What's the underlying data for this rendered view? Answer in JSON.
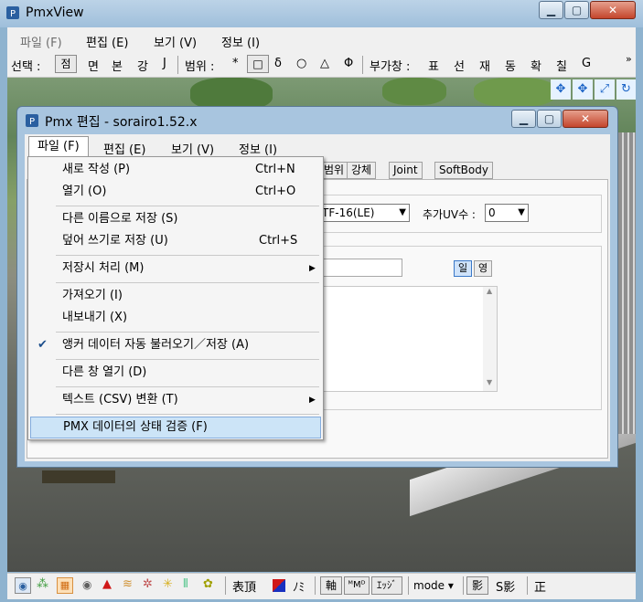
{
  "main_window": {
    "title": "PmxView",
    "menu": [
      "파일 (F)",
      "편집 (E)",
      "보기 (V)",
      "정보 (I)"
    ],
    "toolbar": {
      "select_label": "선택 :",
      "select_items": [
        "점",
        "면",
        "본",
        "강",
        "J"
      ],
      "range_label": "범위 :",
      "range_items": [
        "*",
        "□",
        "δ",
        "○",
        "△",
        "Φ"
      ],
      "extra_label": "부가창 :",
      "extra_items": [
        "표",
        "선",
        "재",
        "동",
        "확",
        "칠",
        "G"
      ],
      "overflow": "»"
    },
    "bottom_toolbar": {
      "text_a": "表頂",
      "text_b": "ﾉﾐ",
      "axis": "軸",
      "mmd": "ᴹMᴰ",
      "edge": "ｴｯｼﾞ",
      "mode": "mode ▾",
      "shadow": "影",
      "s_shadow": "S影",
      "front": "正"
    }
  },
  "editor_window": {
    "title": "Pmx 편집 - sorairo1.52.x",
    "menu": [
      "파일 (F)",
      "편집 (E)",
      "보기 (V)",
      "정보 (I)"
    ],
    "tabs": [
      "범위",
      "강체",
      "Joint",
      "SoftBody"
    ],
    "encoding_value": "TF-16(LE)",
    "uv_label": "추가UV수 :",
    "uv_value": "0",
    "lang_buttons": [
      "일",
      "영"
    ]
  },
  "file_menu": {
    "items": [
      {
        "label": "새로 작성 (P)",
        "shortcut": "Ctrl+N"
      },
      {
        "label": "열기 (O)",
        "shortcut": "Ctrl+O"
      },
      {
        "label": "다른 이름으로 저장 (S)",
        "shortcut": ""
      },
      {
        "label": "덮어 쓰기로 저장 (U)",
        "shortcut": "Ctrl+S"
      },
      {
        "label": "저장시 처리 (M)",
        "shortcut": ""
      },
      {
        "label": "가져오기 (I)",
        "shortcut": ""
      },
      {
        "label": "내보내기 (X)",
        "shortcut": ""
      },
      {
        "label": "앵커 데이터 자동 불러오기／저장 (A)",
        "shortcut": ""
      },
      {
        "label": "다른 창 열기 (D)",
        "shortcut": ""
      },
      {
        "label": "텍스트 (CSV) 변환 (T)",
        "shortcut": ""
      },
      {
        "label": "PMX 데이터의 상태 검증 (F)",
        "shortcut": ""
      }
    ]
  },
  "colors": {
    "accent": "#cce4f7",
    "title_bar": "#a8c5df",
    "close": "#c4452c"
  }
}
